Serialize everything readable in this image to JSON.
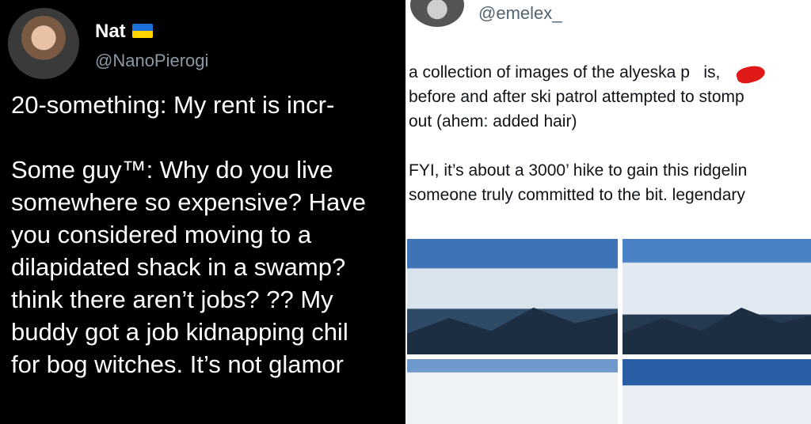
{
  "left_tweet": {
    "name": "Nat",
    "handle": "@NanoPierogi",
    "text": "20-something: My rent is incr-\n\nSome guy™: Why do you live\nsomewhere so expensive? Have\nyou considered moving to a\ndilapidated shack in a swamp?\nthink there aren’t jobs? ?? My\nbuddy got a job kidnapping chil\nfor bog witches. It’s not glamor",
    "flag_icon": "ukraine-flag-icon"
  },
  "right_tweet": {
    "handle": "@emelex_",
    "text": "a collection of images of the alyeska p   is,\nbefore and after ski patrol attempted to stomp\nout (ahem: added hair)\n\nFYI, it’s about a 3000’ hike to gain this ridgelin\nsomeone truly committed to the bit. legendary"
  }
}
